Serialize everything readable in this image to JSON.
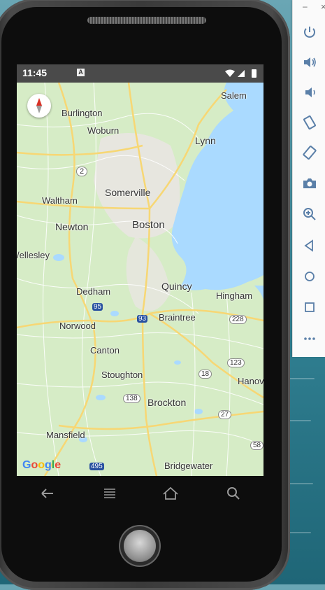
{
  "status_bar": {
    "time": "11:45",
    "notification_glyph": "A"
  },
  "map": {
    "labels": {
      "salem": "Salem",
      "burlington": "Burlington",
      "woburn": "Woburn",
      "lynn": "Lynn",
      "route2": "2",
      "somerville": "Somerville",
      "waltham": "Waltham",
      "boston": "Boston",
      "newton": "Newton",
      "wellesley": "/ellesley",
      "dedham": "Dedham",
      "quincy": "Quincy",
      "hingham": "Hingham",
      "i95": "95",
      "i93": "93",
      "braintree": "Braintree",
      "route228": "228",
      "norwood": "Norwood",
      "canton": "Canton",
      "route123": "123",
      "stoughton": "Stoughton",
      "route18": "18",
      "hanov": "Hanov",
      "route138": "138",
      "brockton": "Brockton",
      "route27": "27",
      "mansfield": "Mansfield",
      "route58": "58",
      "i495": "495",
      "bridgewater": "Bridgewater"
    },
    "attribution": "Google"
  },
  "nav": {
    "back": "back-icon",
    "menu": "menu-icon",
    "home": "home-icon",
    "search": "search-icon"
  },
  "emulator_toolbar": {
    "minimize": "–",
    "close": "×",
    "buttons": [
      "power-icon",
      "volume-up-icon",
      "volume-down-icon",
      "rotate-left-icon",
      "rotate-right-icon",
      "camera-icon",
      "zoom-icon",
      "back-triangle-icon",
      "home-circle-icon",
      "overview-square-icon",
      "more-icon"
    ]
  },
  "colors": {
    "water": "#aadaff",
    "land": "#d6ecc6",
    "road_major": "#f7d774",
    "road_minor": "#ffffff"
  }
}
